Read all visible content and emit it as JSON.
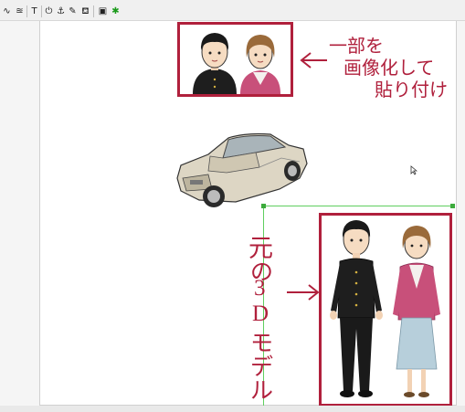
{
  "toolbar": {
    "tools": [
      {
        "glyph": "∿",
        "icon": "curve-icon"
      },
      {
        "glyph": "≊",
        "icon": "pattern-icon"
      },
      {
        "glyph": "T",
        "icon": "text-icon"
      },
      {
        "glyph": "⏻",
        "icon": "rotate-icon"
      },
      {
        "glyph": "⚓",
        "icon": "anchor-icon"
      },
      {
        "glyph": "✎",
        "icon": "pen-icon"
      },
      {
        "glyph": "⛾",
        "icon": "fill-icon"
      },
      {
        "glyph": "▣",
        "icon": "image-icon"
      },
      {
        "glyph": "✱",
        "icon": "green-star-icon"
      }
    ]
  },
  "annotations": {
    "pasted_line1": "一部を",
    "pasted_line2": "画像化して",
    "pasted_line3": "貼り付け",
    "original_vertical": [
      "元",
      "の",
      "3",
      "D",
      "モ",
      "デ",
      "ル"
    ]
  },
  "colors": {
    "accent": "#b0203c",
    "guide": "#5fcf5f"
  }
}
